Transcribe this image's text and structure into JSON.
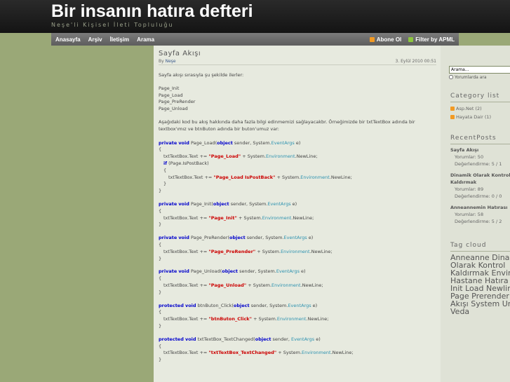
{
  "site": {
    "title": "Bir insanın hatıra defteri",
    "subtitle": "Neşe'li Kişisel İleti Topluluğu"
  },
  "nav": {
    "items": [
      "Anasayfa",
      "Arşiv",
      "İletişim",
      "Arama"
    ],
    "subscribe": "Abone Ol",
    "apml": "Filter by APML"
  },
  "post": {
    "title": "Sayfa Akışı",
    "by_label": "By",
    "author": "Neşe",
    "date": "3. Eylül 2010 00:51",
    "intro": "Sayfa akışı sırasıyla şu şekilde ilerler:",
    "steps": [
      "Page_Init",
      "Page_Load",
      "Page_PreRender",
      "Page_Unload"
    ],
    "desc": "Aşağıdaki kod bu akış hakkında daha fazla bilgi edinmemizi sağlayacakbr. Örneğimizde bir txtTextBox adında bir textbox'ımız ve btnButon adında bir buton'umuz var:"
  },
  "code": {
    "load_sig": "Page_Load(",
    "init_sig": "Page_Init(",
    "prerender_sig": "Page_PreRender(",
    "unload_sig": "Page_Unload(",
    "click_sig": "btnButon_Click(",
    "changed_sig": "txtTextBox_TextChanged(",
    "load_str": "\"Page_Load\"",
    "load_postback_str": "\"Page_Load IsPostBack\"",
    "init_str": "\"Page_Init\"",
    "prerender_str": "\"Page_PreRender\"",
    "unload_str": "\"Page_Unload\"",
    "click_str": "\"btnButon_Click\"",
    "changed_str": "\"txtTextBox_TextChanged\""
  },
  "sidebar": {
    "search_value": "Arama...",
    "search_option": "Yorumlarda ara",
    "category_heading": "Category list",
    "categories": [
      "Asp.Net (2)",
      "Hayata Dair (1)"
    ],
    "recent_heading": "RecentPosts",
    "recent_posts": [
      {
        "title": "Sayfa Akışı",
        "comments": "Yorumlar: 50",
        "rating": "Değerlendirme: 5 / 1"
      },
      {
        "title_l1": "Dinamik Olarak Kontrol",
        "title_l2": "Kaldırmak",
        "comments": "Yorumlar: 89",
        "rating": "Değerlendirme: 0 / 0"
      },
      {
        "title": "Anneannemin Hatırası",
        "comments": "Yorumlar: 58",
        "rating": "Değerlendirme: 5 / 2"
      }
    ],
    "tag_heading": "Tag cloud",
    "tag_lines": [
      "Anneanne Dinamik",
      "Olarak Kontrol",
      "Kaldırmak Environment",
      "Hastane Hatıra",
      "Init Load Newline",
      "Page Prerender",
      "Akışı System Unload",
      "Veda"
    ]
  },
  "colors": {
    "keyword": "#0000cc",
    "string": "#cc0000",
    "type": "#2b91af",
    "feed": "#f29a24"
  }
}
